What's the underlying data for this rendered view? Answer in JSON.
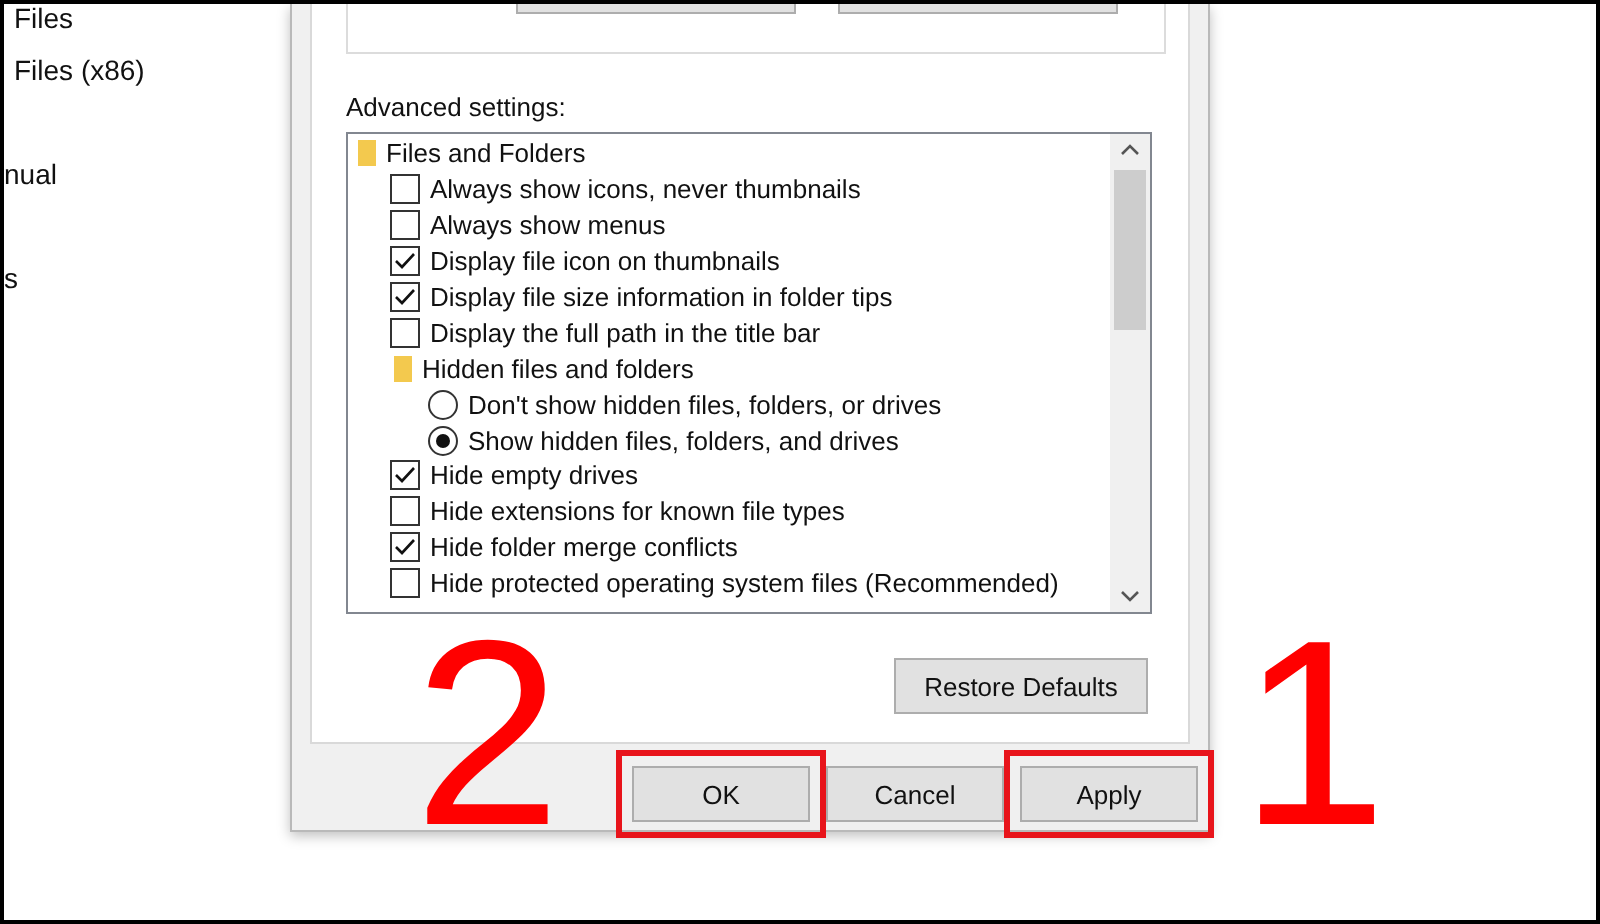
{
  "explorer_nav": {
    "items": [
      "Files",
      "Files (x86)",
      "nual",
      "s"
    ]
  },
  "dialog": {
    "advanced_settings": {
      "label": "Advanced settings:",
      "tree": [
        {
          "kind": "folder",
          "label": "Files and Folders",
          "children": [
            {
              "kind": "checkbox",
              "label": "Always show icons, never thumbnails",
              "checked": false
            },
            {
              "kind": "checkbox",
              "label": "Always show menus",
              "checked": false
            },
            {
              "kind": "checkbox",
              "label": "Display file icon on thumbnails",
              "checked": true
            },
            {
              "kind": "checkbox",
              "label": "Display file size information in folder tips",
              "checked": true
            },
            {
              "kind": "checkbox",
              "label": "Display the full path in the title bar",
              "checked": false
            },
            {
              "kind": "folder",
              "label": "Hidden files and folders",
              "children": [
                {
                  "kind": "radio",
                  "label": "Don't show hidden files, folders, or drives",
                  "selected": false
                },
                {
                  "kind": "radio",
                  "label": "Show hidden files, folders, and drives",
                  "selected": true
                }
              ]
            },
            {
              "kind": "checkbox",
              "label": "Hide empty drives",
              "checked": true
            },
            {
              "kind": "checkbox",
              "label": "Hide extensions for known file types",
              "checked": false
            },
            {
              "kind": "checkbox",
              "label": "Hide folder merge conflicts",
              "checked": true
            },
            {
              "kind": "checkbox",
              "label": "Hide protected operating system files (Recommended)",
              "checked": false
            }
          ]
        }
      ]
    },
    "restore_button": "Restore Defaults",
    "buttons": [
      {
        "label": "OK",
        "highlighted": true
      },
      {
        "label": "Cancel",
        "highlighted": false
      },
      {
        "label": "Apply",
        "highlighted": true
      }
    ]
  },
  "annotations": [
    {
      "label": "2"
    },
    {
      "label": "1"
    }
  ]
}
